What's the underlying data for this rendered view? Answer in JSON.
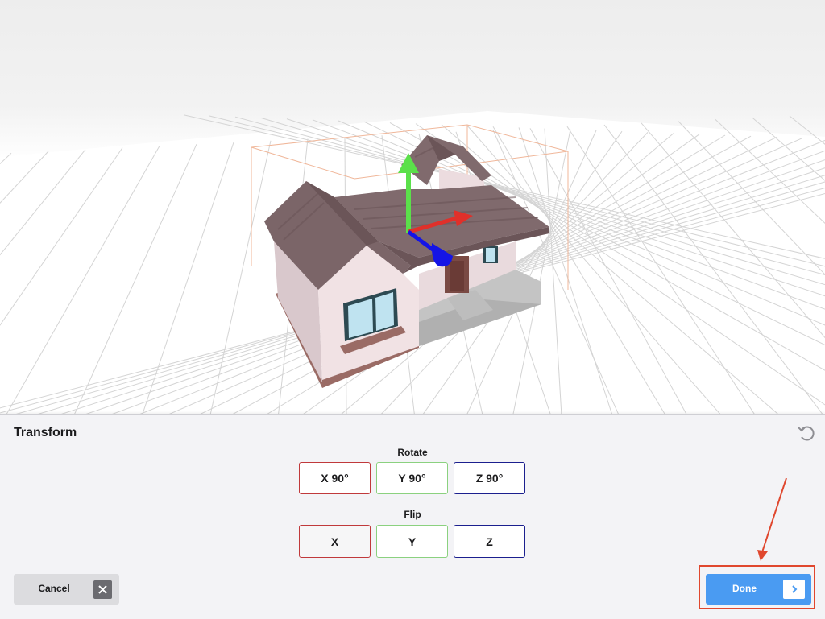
{
  "panel": {
    "title": "Transform",
    "rotate_label": "Rotate",
    "flip_label": "Flip",
    "rotate_buttons": {
      "x": "X  90°",
      "y": "Y  90°",
      "z": "Z  90°"
    },
    "flip_buttons": {
      "x": "X",
      "y": "Y",
      "z": "Z"
    },
    "cancel_label": "Cancel",
    "done_label": "Done"
  },
  "colors": {
    "axis_x": "#e0302a",
    "axis_y": "#5be04a",
    "axis_z": "#1414e6",
    "done_button": "#4a9bf2",
    "annotation": "#e0472e"
  },
  "icons": {
    "reset": "undo-icon",
    "cancel": "close-icon",
    "done": "chevron-right-icon"
  }
}
